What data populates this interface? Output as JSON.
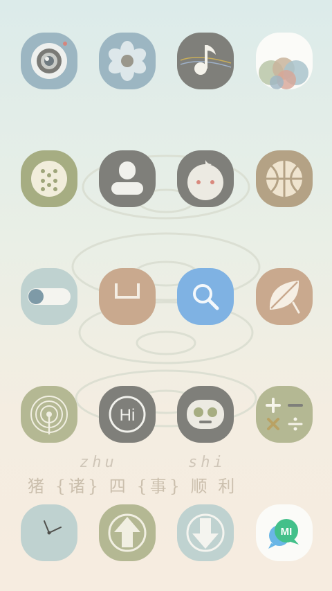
{
  "colors": {
    "bg_top": "#dcebea",
    "bg_bottom": "#f6ece0",
    "slate_blue": "#9cb6c2",
    "gray": "#7f7f7a",
    "olive": "#a6ad82",
    "tan": "#c9a98e",
    "khaki": "#b4a285",
    "sky_blue": "#7fb2e3",
    "mint": "#bfd2d0"
  },
  "home": {
    "rows": [
      {
        "apps": [
          {
            "icon": "camera-icon"
          },
          {
            "icon": "gallery-flower-icon"
          },
          {
            "icon": "music-note-icon"
          },
          {
            "icon": "wallpaper-bubbles-icon"
          }
        ]
      },
      {
        "apps": [
          {
            "icon": "dialer-keypad-icon"
          },
          {
            "icon": "contacts-person-icon"
          },
          {
            "icon": "messaging-face-icon"
          },
          {
            "icon": "browser-ball-icon"
          }
        ]
      },
      {
        "apps": [
          {
            "icon": "settings-toggle-icon"
          },
          {
            "icon": "file-manager-icon"
          },
          {
            "icon": "search-icon"
          },
          {
            "icon": "notes-leaf-icon"
          }
        ]
      },
      {
        "apps": [
          {
            "icon": "radio-broadcast-icon"
          },
          {
            "icon": "hi-chat-icon"
          },
          {
            "icon": "robot-face-icon"
          },
          {
            "icon": "calculator-icon"
          }
        ]
      }
    ],
    "caption": {
      "pinyin_1": "zhu",
      "pinyin_2": "shi",
      "text": "猪 {诸} 四  {事} 顺 利"
    },
    "dock": {
      "apps": [
        {
          "icon": "clock-icon"
        },
        {
          "icon": "upload-arrow-icon"
        },
        {
          "icon": "download-arrow-icon"
        },
        {
          "icon": "mi-chat-icon"
        }
      ]
    }
  }
}
